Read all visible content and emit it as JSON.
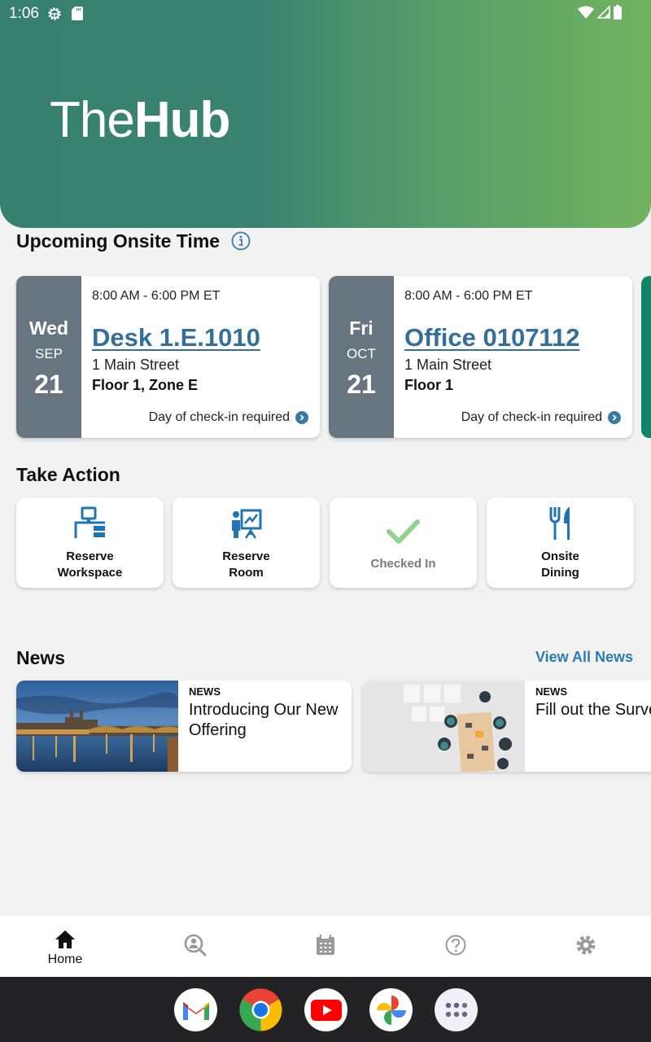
{
  "status_bar": {
    "time": "1:06",
    "icons": [
      "settings-gear-icon",
      "sd-card-icon",
      "wifi-icon",
      "signal-icon",
      "battery-icon"
    ]
  },
  "header": {
    "logo_light": "The",
    "logo_bold": "Hub"
  },
  "upcoming": {
    "title": "Upcoming Onsite Time",
    "info_icon": "info-icon",
    "reservations": [
      {
        "dow": "Wed",
        "month": "SEP",
        "day": "21",
        "time": "8:00 AM - 6:00 PM ET",
        "name": "Desk 1.E.1010",
        "address": "1 Main Street",
        "floor": "Floor 1, Zone E",
        "footer": "Day of check-in required"
      },
      {
        "dow": "Fri",
        "month": "OCT",
        "day": "21",
        "time": "8:00 AM - 6:00 PM ET",
        "name": "Office 0107112",
        "address": "1 Main Street",
        "floor": "Floor 1",
        "footer": "Day of check-in required"
      }
    ]
  },
  "take_action": {
    "title": "Take Action",
    "actions": [
      {
        "label_line1": "Reserve",
        "label_line2": "Workspace",
        "icon": "workspace-desk-icon"
      },
      {
        "label_line1": "Reserve",
        "label_line2": "Room",
        "icon": "presentation-room-icon"
      },
      {
        "label_line1": "Checked In",
        "label_line2": "",
        "icon": "checkmark-icon",
        "disabled": true
      },
      {
        "label_line1": "Onsite",
        "label_line2": "Dining",
        "icon": "fork-knife-icon"
      }
    ]
  },
  "news": {
    "title": "News",
    "view_all": "View All News",
    "items": [
      {
        "tag": "NEWS",
        "title": "Introducing Our New Offering",
        "image": "city-river-night-photo"
      },
      {
        "tag": "NEWS",
        "title": "Fill out the Survey",
        "image": "team-meeting-overhead-photo"
      }
    ]
  },
  "bottom_nav": {
    "items": [
      {
        "label": "Home",
        "icon": "home-icon",
        "active": true
      },
      {
        "label": "",
        "icon": "people-search-icon"
      },
      {
        "label": "",
        "icon": "calendar-icon"
      },
      {
        "label": "",
        "icon": "help-icon"
      },
      {
        "label": "",
        "icon": "settings-icon"
      }
    ]
  },
  "dock": {
    "apps": [
      "Gmail",
      "Chrome",
      "YouTube",
      "Photos",
      "App drawer"
    ]
  },
  "colors": {
    "accent_blue": "#336f98",
    "link_blue": "#2a7bb0",
    "date_panel": "#66757f",
    "check_green": "#8fd48a",
    "icon_blue": "#1f74b5"
  }
}
